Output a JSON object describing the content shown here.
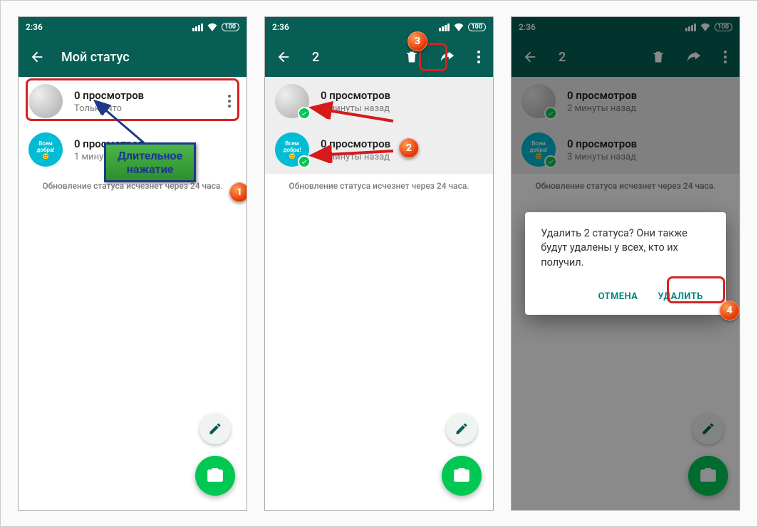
{
  "statusbar": {
    "time": "2:36",
    "battery": "100"
  },
  "screen1": {
    "title": "Мой статус",
    "rows": [
      {
        "views": "0 просмотров",
        "time": "Только что"
      },
      {
        "views": "0 просмотров",
        "time": "1 минуту назад"
      }
    ],
    "notice": "Обновление статуса исчезнет через 24 часа.",
    "callout": "Длительное\nнажатие"
  },
  "screen2": {
    "selected_count": "2",
    "rows": [
      {
        "views": "0 просмотров",
        "time": "2 минуты назад"
      },
      {
        "views": "0 просмотров",
        "time": "3 минуты назад"
      }
    ],
    "notice": "Обновление статуса исчезнет через 24 часа."
  },
  "screen3": {
    "selected_count": "2",
    "rows": [
      {
        "views": "0 просмотров",
        "time": "2 минуты назад"
      },
      {
        "views": "0 просмотров",
        "time": "3 минуты назад"
      }
    ],
    "notice": "Обновление статуса исчезнет через 24 часа.",
    "dialog": {
      "message": "Удалить 2 статуса? Они также будут удалены у всех, кто их получил.",
      "cancel": "ОТМЕНА",
      "confirm": "УДАЛИТЬ"
    }
  },
  "icons": {
    "avatar2_text": "Всем\nдобра!\n😊"
  },
  "annotations": {
    "badge1": "1",
    "badge2": "2",
    "badge3": "3",
    "badge4": "4"
  }
}
